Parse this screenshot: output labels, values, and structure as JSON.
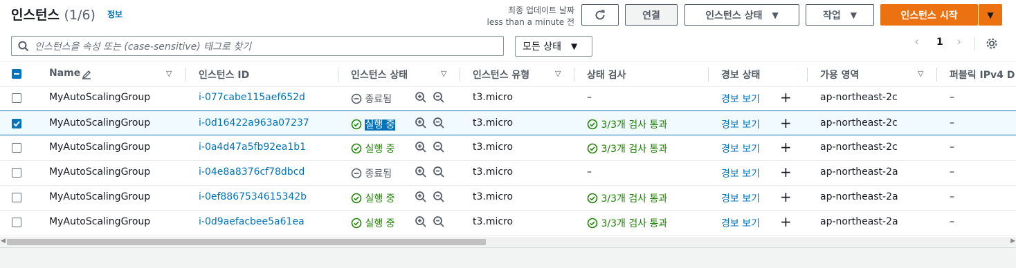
{
  "header": {
    "title": "인스턴스",
    "count": "(1/6)",
    "info_link": "정보",
    "last_updated_label": "최종 업데이트 날짜",
    "last_updated_value": "less than a minute 전",
    "connect_label": "연결",
    "instance_state_label": "인스턴스 상태",
    "actions_label": "작업",
    "launch_label": "인스턴스 시작"
  },
  "search": {
    "placeholder": "인스턴스을 속성 또는 (case-sensitive) 태그로 찾기"
  },
  "filter": {
    "label": "모든 상태"
  },
  "pagination": {
    "page": "1"
  },
  "columns": {
    "name": "Name",
    "id": "인스턴스 ID",
    "state": "인스턴스 상태",
    "type": "인스턴스 유형",
    "status_check": "상태 검사",
    "alarm": "경보 상태",
    "az": "가용 영역",
    "public_ip": "퍼블릭 IPv4 D"
  },
  "rows": [
    {
      "name": "MyAutoScalingGroup",
      "id": "i-077cabe115aef652d",
      "state": "종료됨",
      "type": "t3.micro",
      "check": "–",
      "alarm": "경보 보기",
      "az": "ap-northeast-2c",
      "ip": "–"
    },
    {
      "name": "MyAutoScalingGroup",
      "id": "i-0d16422a963a07237",
      "state": "실행 중",
      "type": "t3.micro",
      "check": "3/3개 검사 통과",
      "alarm": "경보 보기",
      "az": "ap-northeast-2c",
      "ip": "–"
    },
    {
      "name": "MyAutoScalingGroup",
      "id": "i-0a4d47a5fb92ea1b1",
      "state": "실행 중",
      "type": "t3.micro",
      "check": "3/3개 검사 통과",
      "alarm": "경보 보기",
      "az": "ap-northeast-2c",
      "ip": "–"
    },
    {
      "name": "MyAutoScalingGroup",
      "id": "i-04e8a8376cf78dbcd",
      "state": "종료됨",
      "type": "t3.micro",
      "check": "–",
      "alarm": "경보 보기",
      "az": "ap-northeast-2a",
      "ip": "–"
    },
    {
      "name": "MyAutoScalingGroup",
      "id": "i-0ef8867534615342b",
      "state": "실행 중",
      "type": "t3.micro",
      "check": "3/3개 검사 통과",
      "alarm": "경보 보기",
      "az": "ap-northeast-2a",
      "ip": "–"
    },
    {
      "name": "MyAutoScalingGroup",
      "id": "i-0d9aefacbee5a61ea",
      "state": "실행 중",
      "type": "t3.micro",
      "check": "3/3개 검사 통과",
      "alarm": "경보 보기",
      "az": "ap-northeast-2a",
      "ip": "–"
    }
  ],
  "colors": {
    "link": "#0073bb",
    "ok": "#1d8102",
    "primary": "#ec7211"
  },
  "icons": {
    "refresh": "refresh-icon",
    "caret": "caret-down-icon",
    "search": "search-icon",
    "settings": "gear-icon",
    "zoom_in": "zoom-in-icon",
    "zoom_out": "zoom-out-icon",
    "plus": "plus-icon",
    "check": "check-circle-icon",
    "stopped": "minus-circle-icon",
    "edit": "pencil-icon"
  }
}
